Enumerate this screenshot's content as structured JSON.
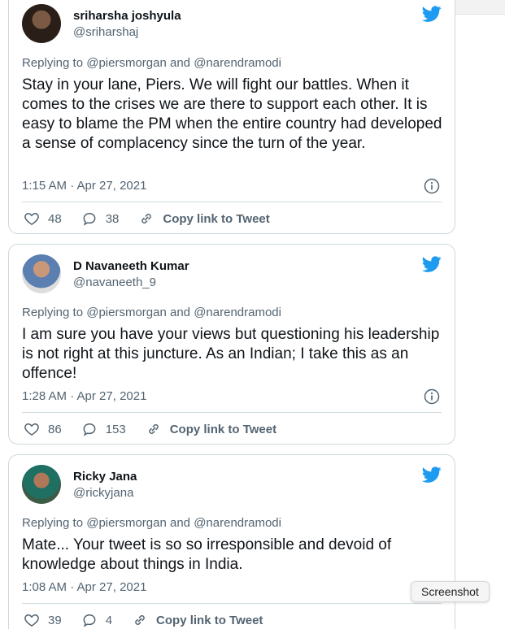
{
  "tweets": [
    {
      "name": "sriharsha joshyula",
      "handle": "@sriharshaj",
      "replying_prefix": "Replying to",
      "replying_to_1": "@piersmorgan",
      "replying_and": "and",
      "replying_to_2": "@narendramodi",
      "text": "Stay in your lane, Piers. We will fight our battles. When it comes to the crises we are there to support each other. It is easy to blame the PM when the entire country had developed a sense of complacency since the turn of the year.",
      "time": "1:15 AM · Apr 27, 2021",
      "likes": "48",
      "replies": "38",
      "copy_link": "Copy link to Tweet"
    },
    {
      "name": "D Navaneeth Kumar",
      "handle": "@navaneeth_9",
      "replying_prefix": "Replying to",
      "replying_to_1": "@piersmorgan",
      "replying_and": "and",
      "replying_to_2": "@narendramodi",
      "text": "I am sure you have your views but questioning his leadership is not right at this juncture. As an Indian; I take this as an offence!",
      "time": "1:28 AM · Apr 27, 2021",
      "likes": "86",
      "replies": "153",
      "copy_link": "Copy link to Tweet"
    },
    {
      "name": "Ricky Jana",
      "handle": "@rickyjana",
      "replying_prefix": "Replying to",
      "replying_to_1": "@piersmorgan",
      "replying_and": "and",
      "replying_to_2": "@narendramodi",
      "text": "Mate... Your tweet is so so irresponsible and devoid of knowledge about things in India.",
      "time": "1:08 AM · Apr 27, 2021",
      "likes": "39",
      "replies": "4",
      "copy_link": "Copy link to Tweet"
    }
  ],
  "tooltip": "Screenshot",
  "colors": {
    "twitter_blue": "#1d9bf0",
    "muted": "#536471",
    "border": "#cfd9de"
  },
  "icons": [
    "twitter-bird-icon",
    "info-icon",
    "heart-icon",
    "reply-bubble-icon",
    "link-icon"
  ]
}
